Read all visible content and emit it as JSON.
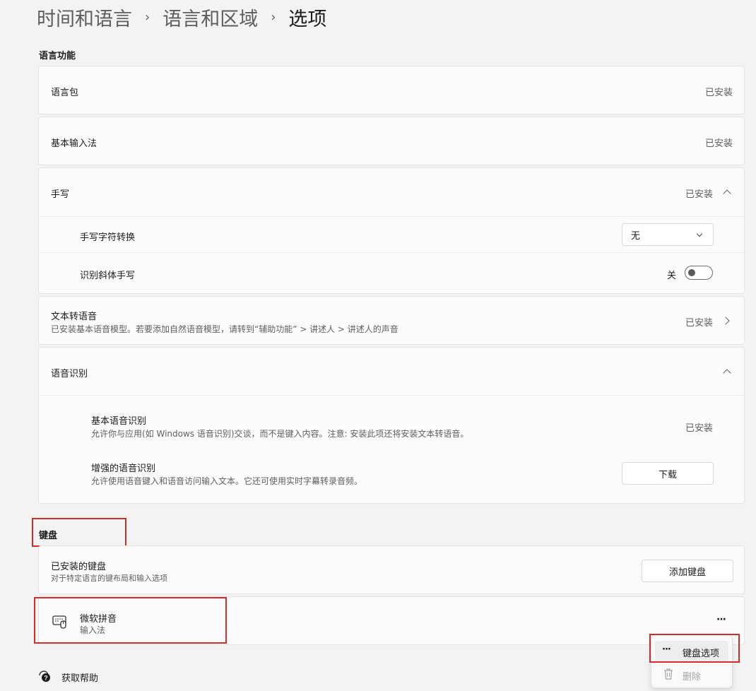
{
  "breadcrumb": {
    "item1": "时间和语言",
    "item2": "语言和区域",
    "current": "选项",
    "separator": "›"
  },
  "language_features": {
    "title": "语言功能",
    "language_pack": {
      "label": "语言包",
      "status": "已安装"
    },
    "basic_input": {
      "label": "基本输入法",
      "status": "已安装"
    },
    "handwriting": {
      "label": "手写",
      "status": "已安装",
      "char_conversion": {
        "label": "手写字符转换",
        "value": "无"
      },
      "italic": {
        "label": "识别斜体手写",
        "toggle_label": "关",
        "toggle_on": false
      }
    },
    "tts": {
      "label": "文本转语音",
      "desc": "已安装基本语音模型。若要添加自然语音模型，请转到“辅助功能” > 讲述人 > 讲述人的声音",
      "status": "已安装"
    },
    "speech": {
      "label": "语音识别",
      "basic": {
        "label": "基本语音识别",
        "desc": "允许你与应用(如 Windows 语音识别)交谈，而不是键入内容。注意: 安装此项还将安装文本转语音。",
        "status": "已安装"
      },
      "enhanced": {
        "label": "增强的语音识别",
        "desc": "允许使用语音键入和语音访问输入文本。它还可使用实时字幕转录音频。",
        "button": "下载"
      }
    }
  },
  "keyboard": {
    "title": "键盘",
    "installed": {
      "label": "已安装的键盘",
      "desc": "对于特定语言的键布局和输入选项",
      "add_button": "添加键盘"
    },
    "item": {
      "name": "微软拼音",
      "type": "输入法",
      "more": "···"
    },
    "menu": {
      "options": "键盘选项",
      "options_icon": "···",
      "delete": "删除"
    }
  },
  "help": {
    "label": "获取帮助"
  },
  "colors": {
    "accent": "#d42b2b",
    "background": "#f3f3f3",
    "card": "#fbfbfb"
  }
}
